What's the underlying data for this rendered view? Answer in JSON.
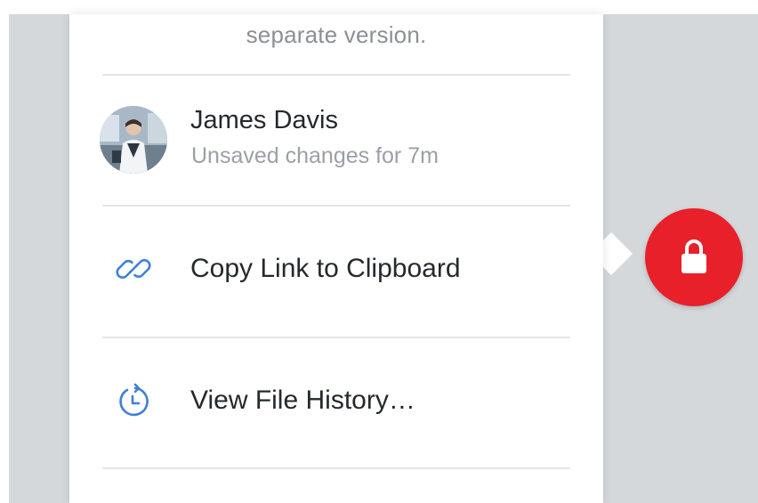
{
  "panel": {
    "note": {
      "line": "separate version."
    },
    "user": {
      "name": "James Davis",
      "status": "Unsaved changes for 7m",
      "avatar_icon": "person-photo"
    },
    "menu": [
      {
        "label": "Copy Link to Clipboard",
        "icon": "link-icon"
      },
      {
        "label": "View File History…",
        "icon": "history-clock-icon"
      }
    ]
  },
  "lock_button": {
    "icon": "lock-icon"
  },
  "colors": {
    "accent_blue": "#3f80d8",
    "lock_red": "#e8202a",
    "text_primary": "#24292d",
    "text_secondary": "#9ba0a5",
    "backdrop": "#d5d8db"
  }
}
